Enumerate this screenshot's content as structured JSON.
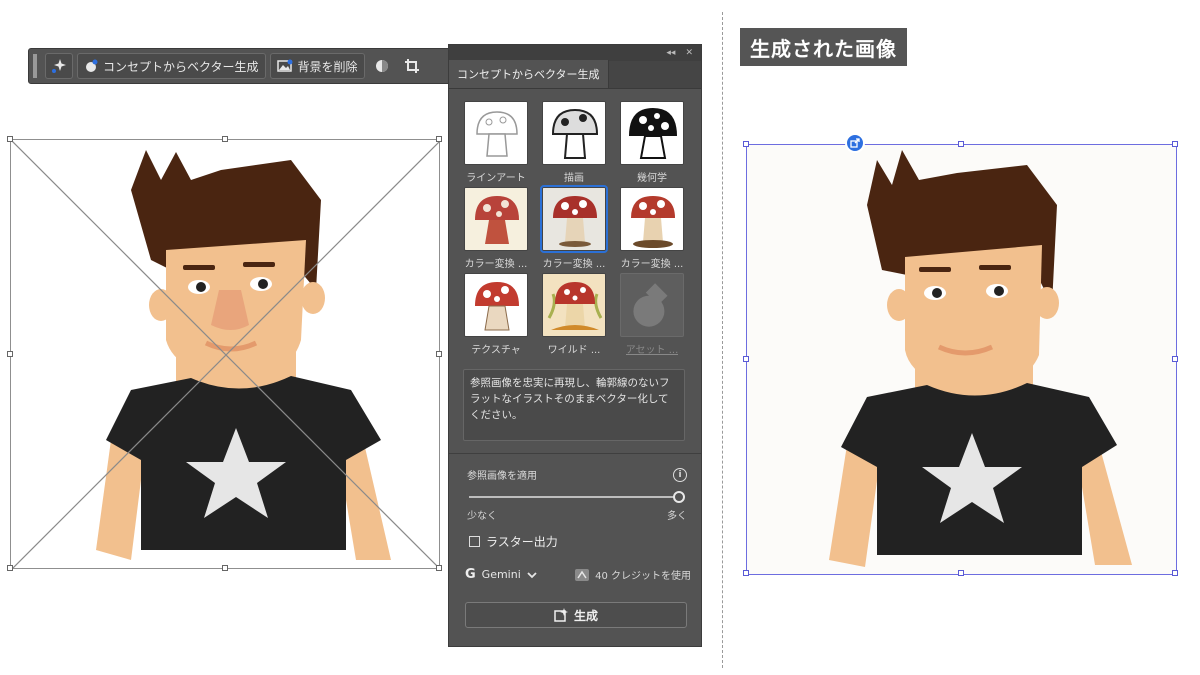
{
  "toolbar": {
    "concept_label": "コンセプトからベクター生成",
    "remove_bg_label": "背景を削除"
  },
  "panel": {
    "tab_label": "コンセプトからベクター生成",
    "styles": [
      {
        "label": "ラインアート",
        "kind": "lineart"
      },
      {
        "label": "描画",
        "kind": "drawing"
      },
      {
        "label": "幾何学",
        "kind": "geometric"
      },
      {
        "label": "カラー変換 ...",
        "kind": "color1"
      },
      {
        "label": "カラー変換 ...",
        "kind": "color2"
      },
      {
        "label": "カラー変換 ...",
        "kind": "color3"
      },
      {
        "label": "テクスチャ",
        "kind": "texture"
      },
      {
        "label": "ワイルド ...",
        "kind": "wild"
      },
      {
        "label": "アセット ...",
        "kind": "asset"
      }
    ],
    "prompt": "参照画像を忠実に再現し、輪郭線のないフラットなイラストそのままベクター化してください。",
    "reference_label": "参照画像を適用",
    "reference_level": 1.0,
    "slider_min_label": "少なく",
    "slider_max_label": "多く",
    "raster_label": "ラスター出力",
    "raster_checked": false,
    "model_label": "Gemini",
    "credits_label": "40 クレジットを使用",
    "generate_label": "生成"
  },
  "right": {
    "title": "生成された画像"
  },
  "colors": {
    "hair": "#4a2511",
    "skin": "#f2c08e",
    "shirt": "#222222",
    "star": "#e6e6e6",
    "accent": "#2d6fe0"
  }
}
